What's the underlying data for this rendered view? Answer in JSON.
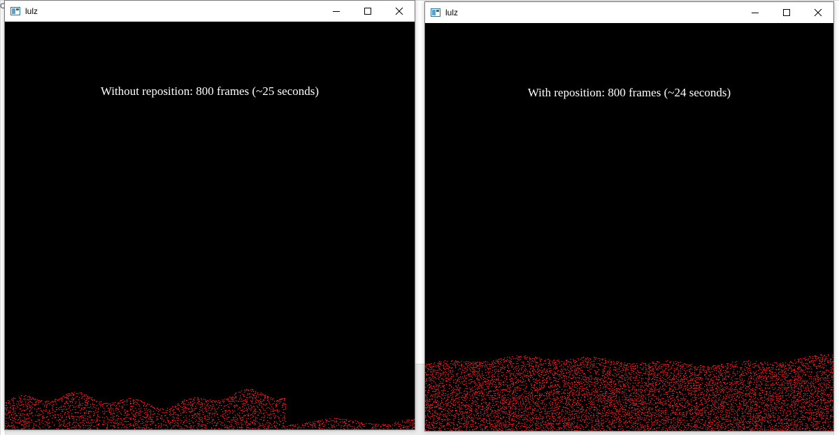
{
  "left_window": {
    "title": "lulz",
    "caption": "Without reposition: 800 frames (~25 seconds)"
  },
  "right_window": {
    "title": "lulz",
    "caption": "With reposition: 800 frames (~24 seconds)"
  },
  "particle_color": "#e8202a",
  "background_color": "#000000"
}
